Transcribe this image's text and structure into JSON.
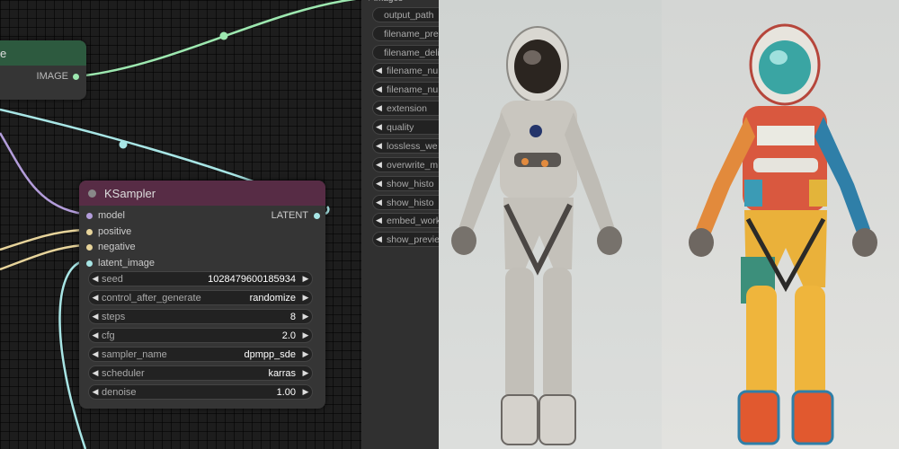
{
  "save_node": {
    "title": "e",
    "output_label": "IMAGE"
  },
  "ksampler": {
    "title": "KSampler",
    "inputs": [
      "model",
      "positive",
      "negative",
      "latent_image"
    ],
    "output_label": "LATENT",
    "widgets": [
      {
        "label": "seed",
        "value": "1028479600185934"
      },
      {
        "label": "control_after_generate",
        "value": "randomize"
      },
      {
        "label": "steps",
        "value": "8"
      },
      {
        "label": "cfg",
        "value": "2.0"
      },
      {
        "label": "sampler_name",
        "value": "dpmpp_sde"
      },
      {
        "label": "scheduler",
        "value": "karras"
      },
      {
        "label": "denoise",
        "value": "1.00"
      }
    ]
  },
  "images_panel": {
    "header": "images",
    "widgets": [
      {
        "label": "output_path",
        "type": "text"
      },
      {
        "label": "filename_pre",
        "type": "text"
      },
      {
        "label": "filename_deli",
        "type": "text"
      },
      {
        "label": "filename_nu",
        "type": "number"
      },
      {
        "label": "filename_nu",
        "type": "number"
      },
      {
        "label": "extension",
        "type": "number"
      },
      {
        "label": "quality",
        "type": "number"
      },
      {
        "label": "lossless_we",
        "type": "number"
      },
      {
        "label": "overwrite_m",
        "type": "number"
      },
      {
        "label": "show_histo",
        "type": "number"
      },
      {
        "label": "show_histo",
        "type": "number"
      },
      {
        "label": "embed_work",
        "type": "number"
      },
      {
        "label": "show_previe",
        "type": "number"
      }
    ]
  },
  "colors": {
    "model_slot": "#b39ddb",
    "conditioning_slot": "#e7d49b",
    "latent_slot": "#a8e6e6",
    "image_slot": "#9de8b0",
    "ksampler_title_bg": "#572c45",
    "save_title_bg": "#2d5a3f"
  }
}
